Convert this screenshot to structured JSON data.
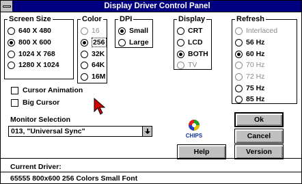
{
  "window": {
    "title": "Display Driver Control Panel"
  },
  "screen_size": {
    "legend": "Screen Size",
    "options": [
      "640 X 480",
      "800 X 600",
      "1024 X 768",
      "1280 X 1024"
    ],
    "selected": "800 X 600"
  },
  "color": {
    "legend": "Color",
    "options": [
      "16",
      "256",
      "32K",
      "64K",
      "16M"
    ],
    "selected": "256",
    "disabled": [
      "16"
    ]
  },
  "dpi": {
    "legend": "DPI",
    "options": [
      "Small",
      "Large"
    ],
    "selected": "Small"
  },
  "display": {
    "legend": "Display",
    "options": [
      "CRT",
      "LCD",
      "BOTH",
      "TV"
    ],
    "selected": "BOTH",
    "disabled": [
      "TV"
    ]
  },
  "refresh": {
    "legend": "Refresh",
    "options": [
      "Interlaced",
      "56 Hz",
      "60 Hz",
      "70 Hz",
      "72 Hz",
      "75 Hz",
      "85 Hz"
    ],
    "selected": "60 Hz",
    "disabled": [
      "Interlaced",
      "70 Hz",
      "72 Hz"
    ]
  },
  "checkboxes": {
    "cursor_animation": "Cursor Animation",
    "big_cursor": "Big Cursor"
  },
  "monitor": {
    "label": "Monitor Selection",
    "value": "013, \"Universal Sync\""
  },
  "buttons": {
    "ok": "Ok",
    "cancel": "Cancel",
    "help": "Help",
    "version": "Version"
  },
  "logo_text": "CHIPS",
  "status": {
    "current_driver_label": "Current Driver:",
    "driver_info": "65555 800x600 256 Colors Small Font"
  }
}
